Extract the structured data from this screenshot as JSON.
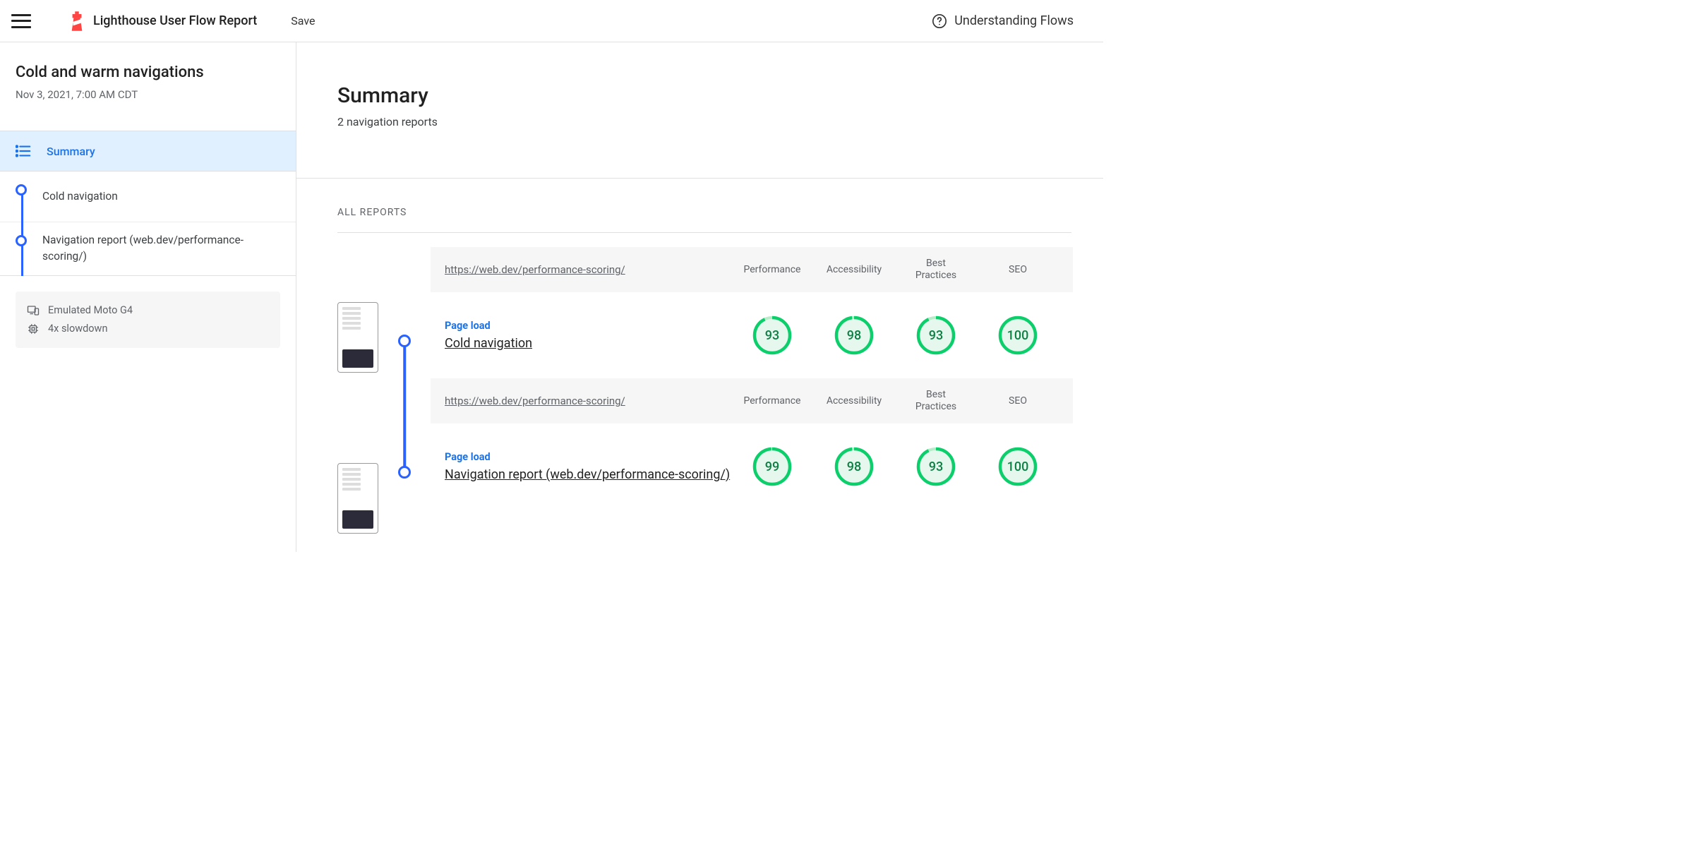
{
  "header": {
    "app_title": "Lighthouse User Flow Report",
    "save_label": "Save",
    "help_label": "Understanding Flows"
  },
  "sidebar": {
    "flow_title": "Cold and warm navigations",
    "flow_date": "Nov 3, 2021, 7:00 AM CDT",
    "summary_label": "Summary",
    "items": [
      {
        "label": "Cold navigation"
      },
      {
        "label": "Navigation report (web.dev/performance-scoring/)"
      }
    ],
    "settings": {
      "device": "Emulated Moto G4",
      "cpu": "4x slowdown"
    }
  },
  "main": {
    "title": "Summary",
    "subtitle": "2 navigation reports",
    "all_reports_label": "ALL REPORTS",
    "columns": [
      "Performance",
      "Accessibility",
      "Best Practices",
      "SEO"
    ],
    "step_type_label": "Page load",
    "reports": [
      {
        "url": "https://web.dev/performance-scoring/",
        "name": "Cold navigation",
        "scores": [
          93,
          98,
          93,
          100
        ]
      },
      {
        "url": "https://web.dev/performance-scoring/",
        "name": "Navigation report (web.dev/performance-scoring/)",
        "scores": [
          99,
          98,
          93,
          100
        ]
      }
    ]
  },
  "colors": {
    "accent": "#1a73e8",
    "flow_blue": "#2962ff",
    "pass_green": "#0CCE6B",
    "pass_fill": "#E6F8EE"
  }
}
